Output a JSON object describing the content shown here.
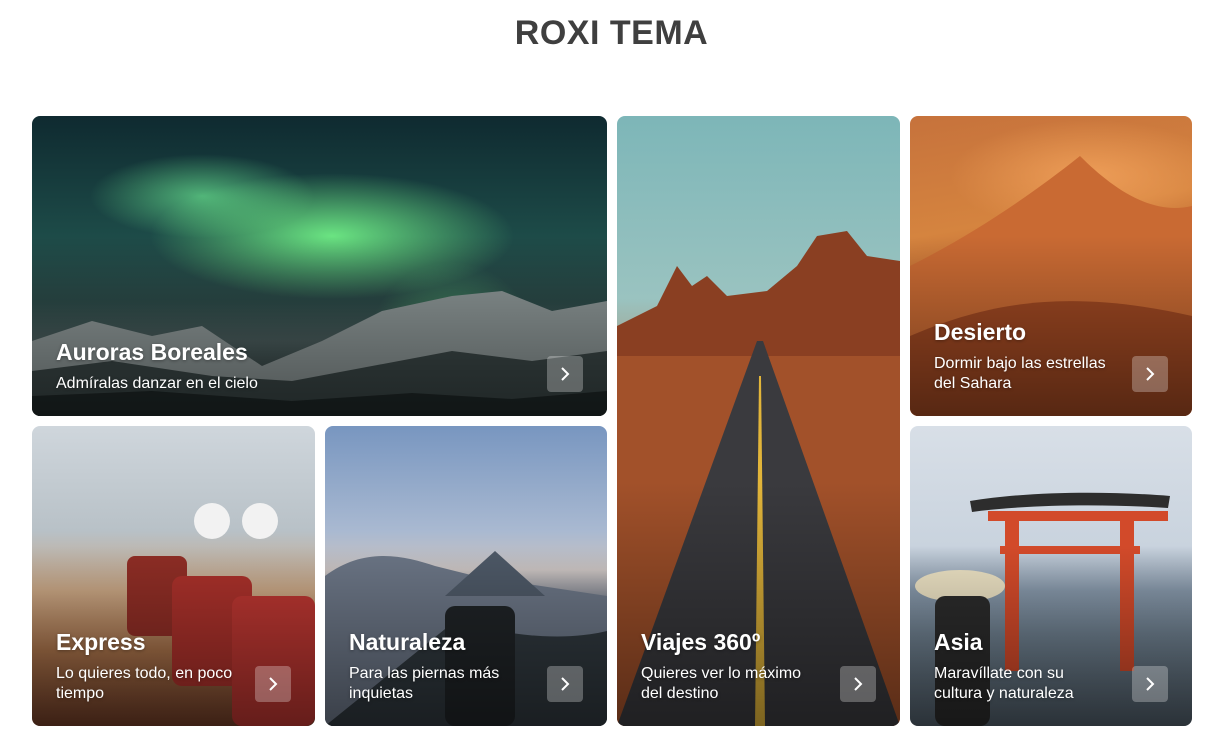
{
  "page": {
    "title": "ROXI TEMA"
  },
  "cards": [
    {
      "title": "Auroras Boreales",
      "subtitle": "Admíralas danzar en el cielo"
    },
    {
      "title": "Viajes 360º",
      "subtitle": "Quieres ver lo máximo del destino"
    },
    {
      "title": "Desierto",
      "subtitle": "Dormir bajo las estrellas del Sahara"
    },
    {
      "title": "Express",
      "subtitle": "Lo quieres todo, en poco tiempo"
    },
    {
      "title": "Naturaleza",
      "subtitle": "Para las piernas más inquietas"
    },
    {
      "title": "Asia",
      "subtitle": "Maravíllate con su cultura y naturaleza"
    }
  ],
  "icons": {
    "card_arrow": "chevron-right-icon"
  }
}
